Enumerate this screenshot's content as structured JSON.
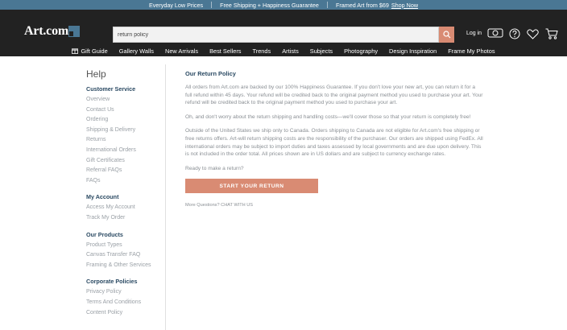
{
  "promo": {
    "item1": "Everyday Low Prices",
    "item2": "Free Shipping + Happiness Guarantee",
    "item3": "Framed Art from $69",
    "link": "Shop Now"
  },
  "header": {
    "logo": "Art.com",
    "search_value": "return policy",
    "login": "Log in"
  },
  "nav": [
    "Gift Guide",
    "Gallery Walls",
    "New Arrivals",
    "Best Sellers",
    "Trends",
    "Artists",
    "Subjects",
    "Photography",
    "Design Inspiration",
    "Frame My Photos"
  ],
  "sidebar": {
    "title": "Help",
    "sections": [
      {
        "heading": "Customer Service",
        "links": [
          "Overview",
          "Contact Us",
          "Ordering",
          "Shipping & Delivery",
          "Returns",
          "International Orders",
          "Gift Certificates",
          "Referral FAQs",
          "FAQs"
        ]
      },
      {
        "heading": "My Account",
        "links": [
          "Access My Account",
          "Track My Order"
        ]
      },
      {
        "heading": "Our Products",
        "links": [
          "Product Types",
          "Canvas Transfer FAQ",
          "Framing & Other Services"
        ]
      },
      {
        "heading": "Corporate Policies",
        "links": [
          "Privacy Policy",
          "Terms And Conditions",
          "Content Policy"
        ]
      }
    ]
  },
  "content": {
    "title": "Our Return Policy",
    "p1": "All orders from Art.com are backed by our 100% Happiness Guarantee. If you don't love your new art, you can return it for a full refund within 45 days. Your refund will be credited back to the original payment method you used to purchase your art. Your refund will be credited back to the original payment method you used to purchase your art.",
    "p2": "Oh, and don't worry about the return shipping and handling costs—we'll cover those so that your return is completely free!",
    "p3": "Outside of the United States we ship only to Canada. Orders shipping to Canada are not eligible for Art.com's free shipping or free returns offers. Art-will return shipping costs are the responsibility of the purchaser. Our orders are shipped using FedEx. All international orders may be subject to import duties and taxes assessed by local governments and are due upon delivery. This is not included in the order total. All prices shown are in US dollars and are subject to currency exchange rates.",
    "p4": "Ready to make a return?",
    "cta": "START YOUR RETURN",
    "more": "More Questions? CHAT WITH US"
  },
  "colors": {
    "promo_bg": "#4a7794",
    "header_bg": "#222222",
    "accent": "#d98b73",
    "heading": "#2b4a63"
  }
}
